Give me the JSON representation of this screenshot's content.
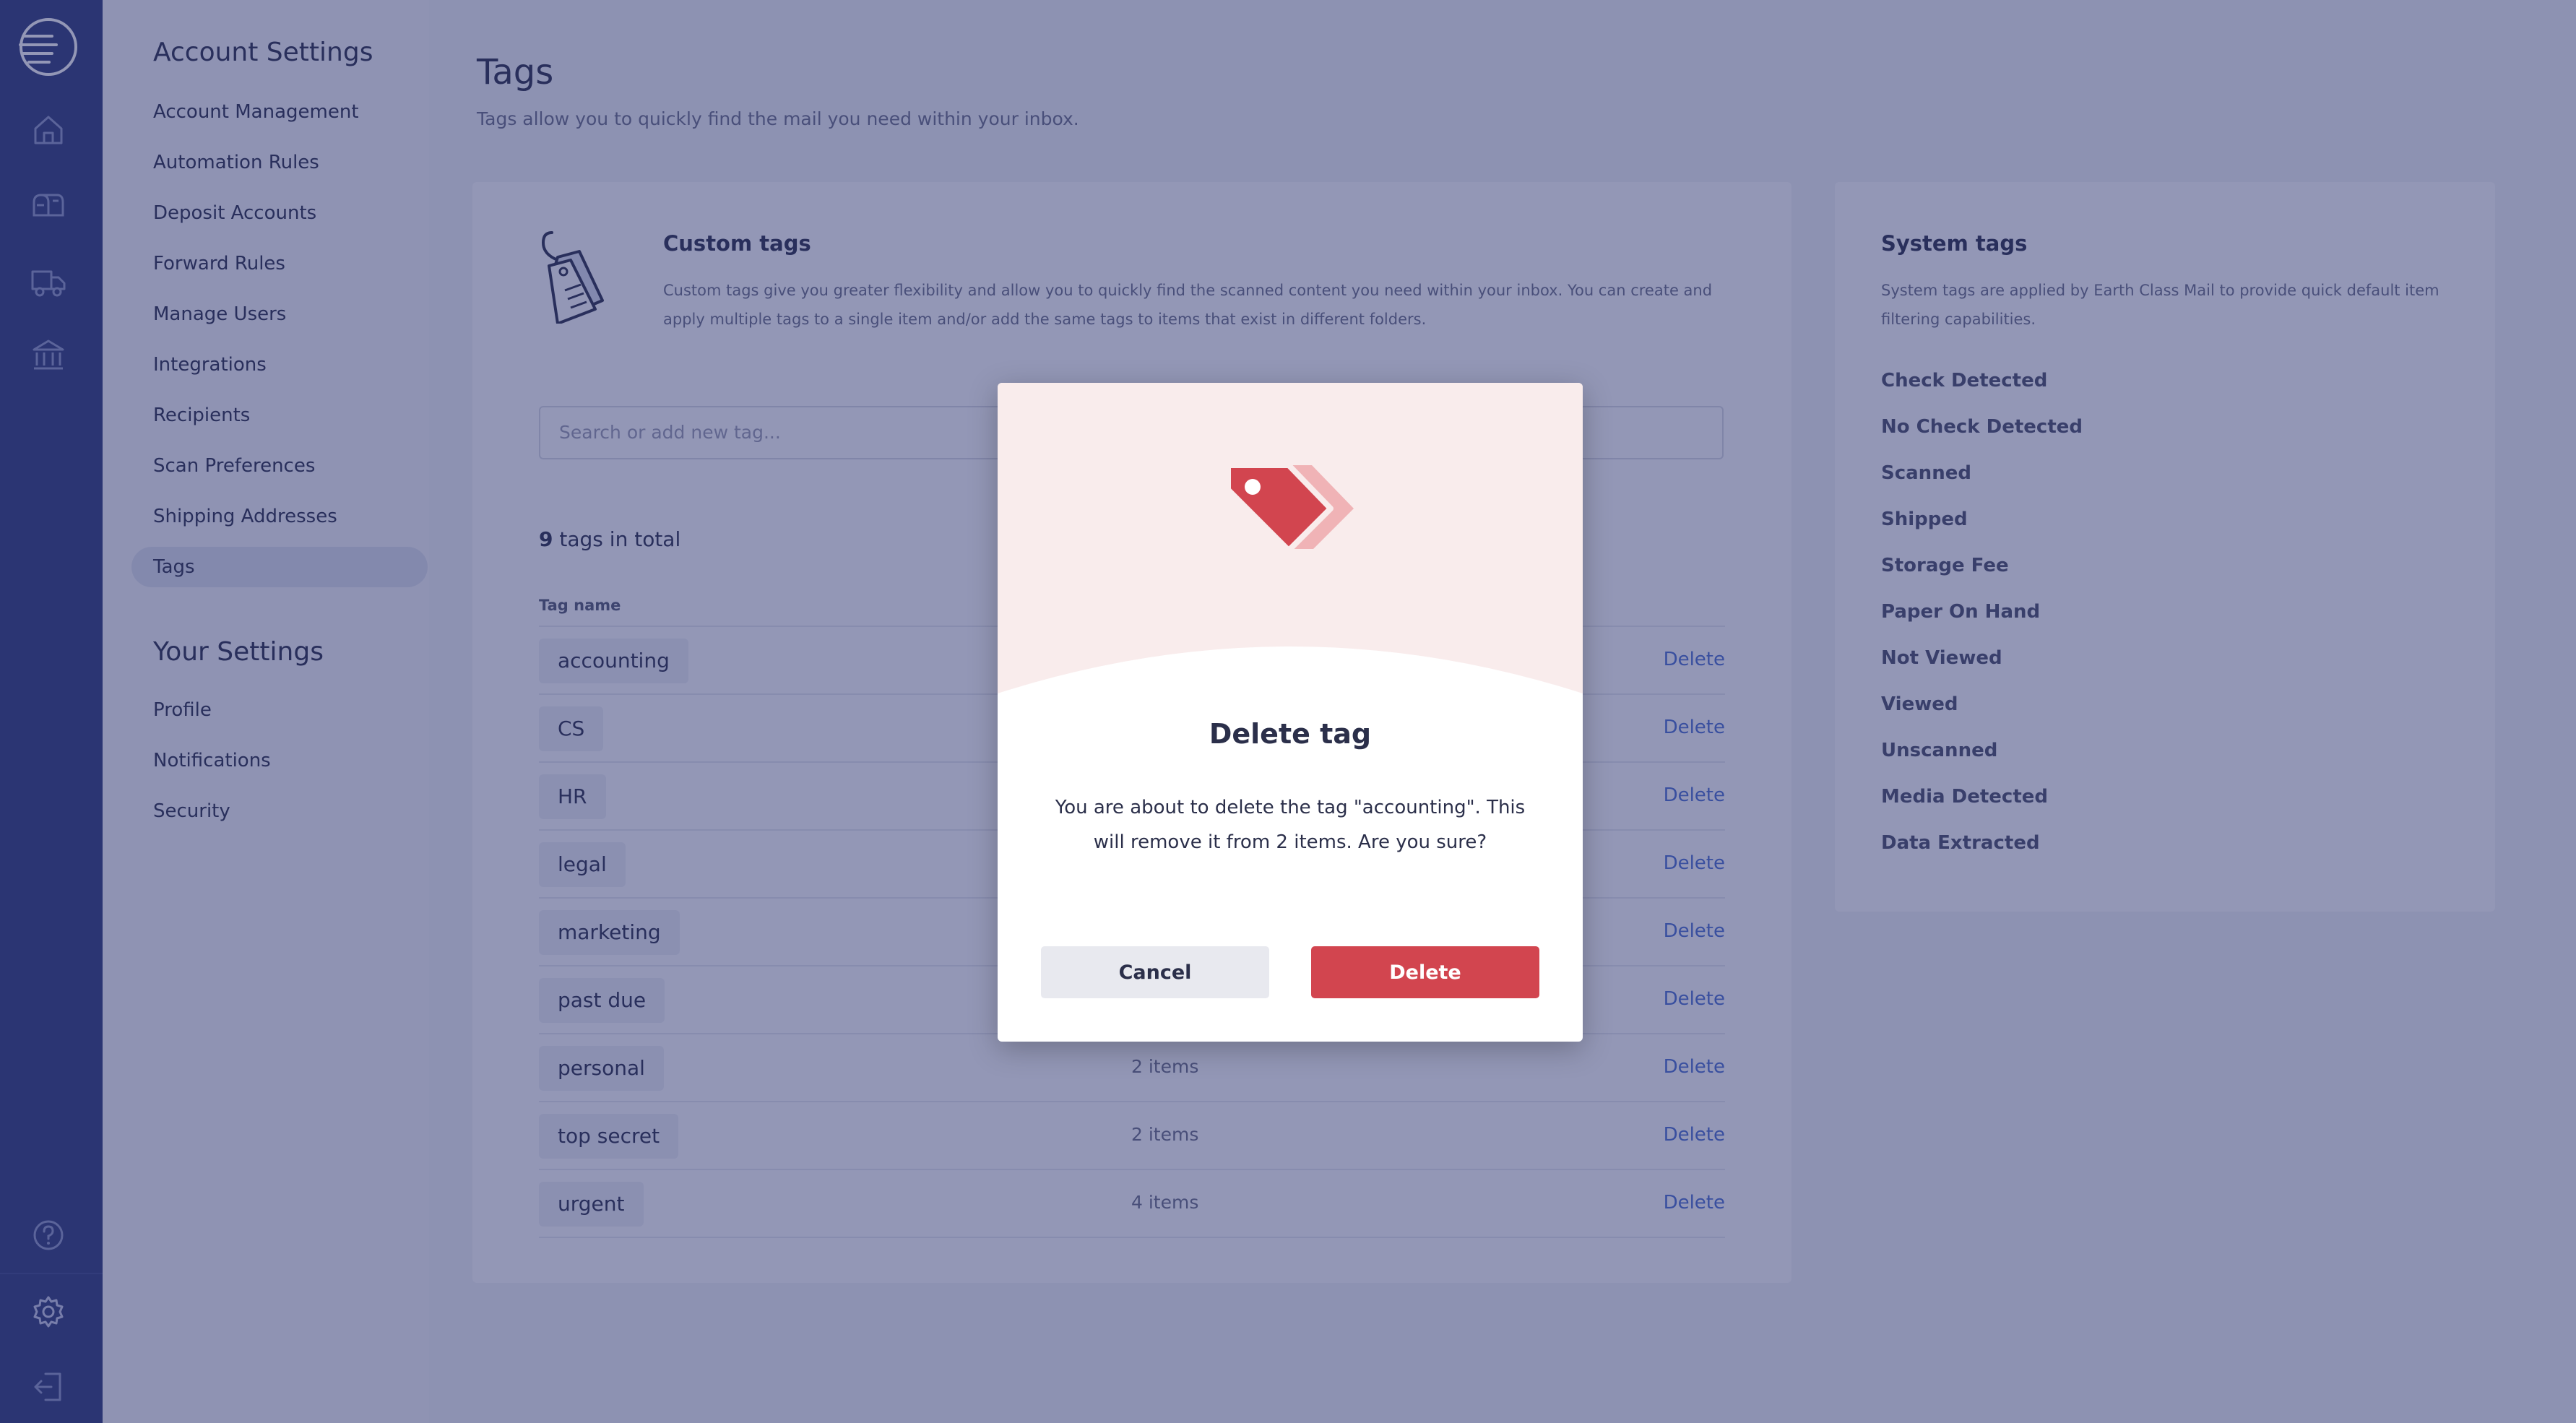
{
  "sidebar_nav": {
    "account_heading": "Account Settings",
    "account_items": [
      "Account Management",
      "Automation Rules",
      "Deposit Accounts",
      "Forward Rules",
      "Manage Users",
      "Integrations",
      "Recipients",
      "Scan Preferences",
      "Shipping Addresses",
      "Tags"
    ],
    "your_heading": "Your Settings",
    "your_items": [
      "Profile",
      "Notifications",
      "Security"
    ],
    "active_item": "Tags"
  },
  "rail_icons": [
    "logo-icon",
    "home-icon",
    "mailbox-icon",
    "truck-icon",
    "bank-icon",
    "help-icon",
    "gear-icon",
    "logout-icon"
  ],
  "page": {
    "title": "Tags",
    "subtitle": "Tags allow you to quickly find the mail you need within your inbox."
  },
  "custom_tags": {
    "title": "Custom tags",
    "description": "Custom tags give you greater flexibility and allow you to quickly find the scanned content you need within your inbox. You can create and apply multiple tags to a single item and/or add the same tags to items that exist in different folders.",
    "search_placeholder": "Search or add new tag...",
    "count_number": "9",
    "count_text": " tags in total",
    "column_header": "Tag name",
    "delete_label": "Delete",
    "rows": [
      {
        "name": "accounting",
        "items": ""
      },
      {
        "name": "CS",
        "items": ""
      },
      {
        "name": "HR",
        "items": ""
      },
      {
        "name": "legal",
        "items": ""
      },
      {
        "name": "marketing",
        "items": ""
      },
      {
        "name": "past due",
        "items": ""
      },
      {
        "name": "personal",
        "items": "2 items"
      },
      {
        "name": "top secret",
        "items": "2 items"
      },
      {
        "name": "urgent",
        "items": "4 items"
      }
    ]
  },
  "system_tags": {
    "title": "System tags",
    "description": "System tags are applied by Earth Class Mail to provide quick default item filtering capabilities.",
    "items": [
      "Check Detected",
      "No Check Detected",
      "Scanned",
      "Shipped",
      "Storage Fee",
      "Paper On Hand",
      "Not Viewed",
      "Viewed",
      "Unscanned",
      "Media Detected",
      "Data Extracted"
    ]
  },
  "modal": {
    "title": "Delete tag",
    "message": "You are about to delete the tag \"accounting\". This will remove it from 2 items. Are you sure?",
    "cancel_label": "Cancel",
    "delete_label": "Delete"
  },
  "colors": {
    "rail": "#2e3a78",
    "accent_link": "#4a6fd1",
    "danger": "#d2454f",
    "modal_hero": "#f9ecec"
  }
}
